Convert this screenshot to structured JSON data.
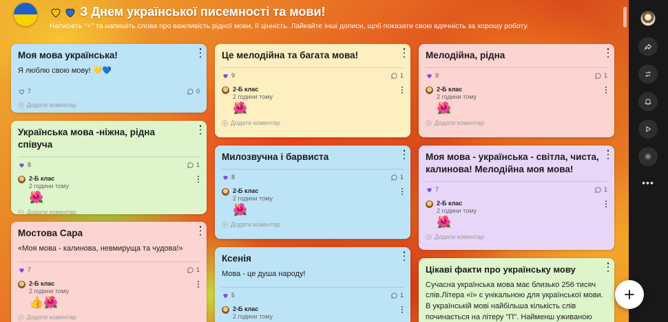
{
  "board": {
    "title": "З Днем української писемності та мови!",
    "subtitle": "Натисніть \"+\" та напишіть слова про важливість рідної мови, її цінність. Лайкайте інші дописи, щоб показати свою вдячність за хорошу роботу.",
    "add_comment_label": "Додати коментар"
  },
  "colors": {
    "blue": "#bde3f7",
    "yellow": "#fdefbf",
    "pink": "#fcd4d2",
    "green": "#def5cb",
    "purple": "#e8d6f8",
    "like_filled": "#7b52d6",
    "heart_yellow": "#f5c400",
    "heart_blue": "#1e6fd9"
  },
  "posts": [
    {
      "title": "Моя мова українська!",
      "body": "Я люблю свою мову! 💛💙",
      "likes": "7",
      "comments": "0"
    },
    {
      "title": "Українська мова -ніжна, рідна співуча",
      "likes": "8",
      "comments": "1",
      "comment": {
        "author": "2-Б клас",
        "time": "2 години тому",
        "emoji": "🌺"
      }
    },
    {
      "title": "Мостова Сара",
      "body": "«Моя мова - калинова, невмируща та чудова!»",
      "likes": "7",
      "comments": "1",
      "comment": {
        "author": "2-Б клас",
        "time": "2 години тому",
        "emoji": "👍🌺"
      }
    },
    {
      "title": "Це мелодійна та багата мова!",
      "likes": "9",
      "comments": "1",
      "comment": {
        "author": "2-Б клас",
        "time": "2 години тому",
        "emoji": "🌺"
      }
    },
    {
      "title": "Милозвучна і барвиста",
      "likes": "8",
      "comments": "1",
      "comment": {
        "author": "2-Б клас",
        "time": "2 години тому",
        "emoji": "🌺"
      }
    },
    {
      "title": "Ксенія",
      "body": "Мова - це душа народу!",
      "likes": "5",
      "comments": "1",
      "comment": {
        "author": "2-Б клас",
        "time": "2 години тому"
      }
    },
    {
      "title": "Мелодійна, рідна",
      "likes": "9",
      "comments": "1",
      "comment": {
        "author": "2-Б клас",
        "time": "2 години тому",
        "emoji": "🌺"
      }
    },
    {
      "title": "Моя мова - українська - світла, чиста, калинова! Мелодійна моя мова!",
      "likes": "7",
      "comments": "1",
      "comment": {
        "author": "2-Б клас",
        "time": "2 години тому",
        "emoji": "🌺"
      }
    },
    {
      "title": "Цікаві факти про українську мову",
      "body": "Сучасна українська мова має близько 256 тисяч слів.Літера «ї» є унікальною для української мови. В українській мові найбільша кількість слів починається на літеру \"П\". Найменш уживаною літерою"
    }
  ],
  "icons": {
    "like": "heart-icon",
    "comment": "speech-bubble-icon",
    "menu": "vertical-dots-icon",
    "share": "share-arrow-icon",
    "remake": "remake-icon",
    "notify": "bell-icon",
    "slideshow": "play-icon",
    "settings": "gear-icon",
    "more": "horizontal-dots-icon",
    "add": "plus-icon"
  }
}
